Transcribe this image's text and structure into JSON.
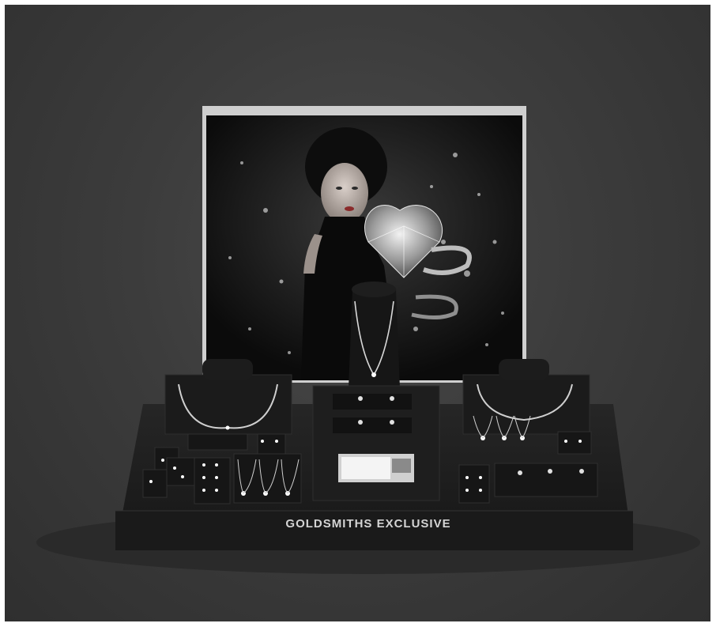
{
  "scene": {
    "description_label": "",
    "brand": {
      "text": "GOLDSMITHS EXCLUSIVE",
      "color": "#d4d4d4"
    },
    "colors": {
      "backdrop": "#3c3c3c",
      "plinth": "#1f1f1f",
      "velvet": "#141414",
      "silver": "#c9c9c9"
    }
  }
}
